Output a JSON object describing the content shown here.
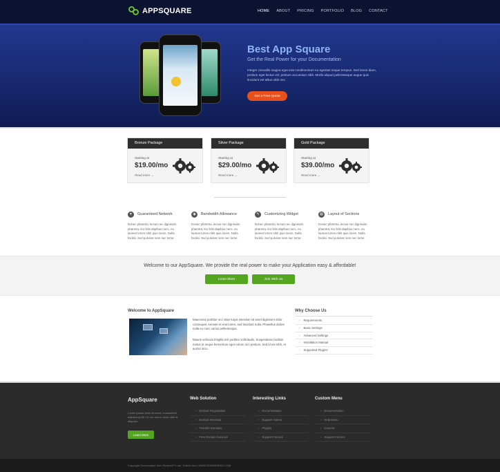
{
  "brand": {
    "name": "APPSQUARE"
  },
  "nav": {
    "items": [
      "HOME",
      "ABOUT",
      "PRICING",
      "PORTFOLIO",
      "BLOG",
      "CONTACT"
    ]
  },
  "hero": {
    "title": "Best App Square",
    "subtitle": "Get the Real Power for your Documentation",
    "body": "Integer convallis magna eget erat condimentum eu egestas neque tempus. Sed lorem diam, pretium eget lectus vel, pretium accumsan nibh. Morbi aliquet pellentesque augue quis tincidunt vel tellus nibh nec.",
    "button": "Get a Free Quote"
  },
  "pricing": [
    {
      "name": "Bronze Package",
      "starting": "Starting at",
      "price": "$19.00/mo",
      "more": "Read more →"
    },
    {
      "name": "Silver Package",
      "starting": "Starting at",
      "price": "$29.00/mo",
      "more": "Read more →"
    },
    {
      "name": "Gold Package",
      "starting": "Starting at",
      "price": "$39.00/mo",
      "more": "Read more →"
    }
  ],
  "features": [
    {
      "title": "Guaranteed Network",
      "icon": "heart-icon",
      "text": "Donec pharetra, lectus nec dignissim pharetra, leo felis dapibus nunc, eu laoreet lorem nibh quis lorem. Nulla facilisi. Sed pulvinar sem nec tortor."
    },
    {
      "title": "Bandwidth Allowance",
      "icon": "gauge-icon",
      "text": "Donec pharetra, lectus nec dignissim pharetra, leo felis dapibus nunc, eu laoreet lorem nibh quis lorem. Nulla facilisi. Sed pulvinar sem nec tortor."
    },
    {
      "title": "Customizing Widget",
      "icon": "wrench-icon",
      "text": "Donec pharetra, lectus nec dignissim pharetra, leo felis dapibus nunc, eu laoreet lorem nibh quis lorem. Nulla facilisi. Sed pulvinar sem nec tortor."
    },
    {
      "title": "Layout of Sections",
      "icon": "layout-icon",
      "text": "Donec pharetra, lectus nec dignissim pharetra, leo felis dapibus nunc, eu laoreet lorem nibh quis lorem. Nulla facilisi. Sed pulvinar sem nec tortor."
    }
  ],
  "band": {
    "text": "Welcome to our AppSquare. We provide the real power to make your Application easy & affordable!",
    "learn_more": "Learn More",
    "join": "Join With Us"
  },
  "welcome": {
    "title": "Welcome to AppSquare",
    "para1": "Maecenas porttitor orci vitae turpis interdum sit amet dignissim dolor consequat. Aenean et erat lorem, sed tincidunt nulla. Phasellus dolore nulla eu nunc varius pellentesque.",
    "para2": "Mauris vehicula fringilla nisl porttitor sollicitudin. Suspendisse facilisis metus et neque fermentum eget rutrum orci pretium. Sed id est nibh, et auctor arcu."
  },
  "why": {
    "title": "Why Choose Us",
    "items": [
      "Requirements",
      "Basic Settings",
      "Advanced Settings",
      "Installation Manual",
      "Supported Plugins"
    ]
  },
  "footer": {
    "brand": "AppSquare",
    "about": "Lorem ipsum dolor sit amet, consectetur adipiscing elit. Ut nec nisl et dolor nibh et aliquam.",
    "button": "Learn More",
    "columns": [
      {
        "title": "Web Solution",
        "items": [
          "Domain Registration",
          "Domain Renewal",
          "Transfer Domains",
          "Free Domain Services"
        ]
      },
      {
        "title": "Interesting Links",
        "items": [
          "Documentation",
          "Support Videos",
          "Plugins",
          "Support Forums"
        ]
      },
      {
        "title": "Custom Menu",
        "items": [
          "Documentation",
          "Help Menu",
          "Careers",
          "Support Forums"
        ]
      }
    ],
    "copyright": "Copyright Downloaded from RelaxedTX.net. Collect from WWW.DOWNDEMO.COM"
  },
  "colors": {
    "accent_green": "#54a51f",
    "accent_orange": "#e8501c",
    "hero_blue": "#1a2c77",
    "footer_dark": "#2b2b2b"
  }
}
